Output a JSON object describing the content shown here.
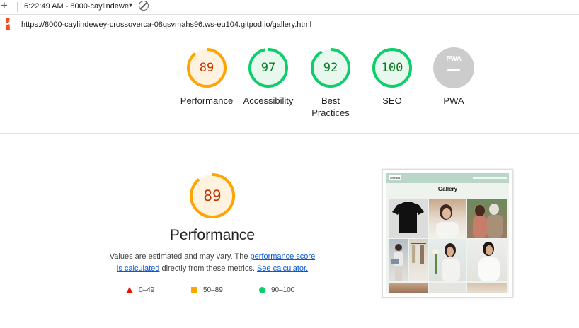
{
  "toolbar": {
    "timestamp": "6:22:49 AM - 8000-caylindewe"
  },
  "urlbar": {
    "url": "https://8000-caylindewey-crossoverca-08qsvmahs96.ws-eu104.gitpod.io/gallery.html"
  },
  "gauges": [
    {
      "label": "Performance",
      "score": "89",
      "value": 0.89,
      "status": "average",
      "color": "#ffa400"
    },
    {
      "label": "Accessibility",
      "score": "97",
      "value": 0.97,
      "status": "pass",
      "color": "#0cce6b"
    },
    {
      "label": "Best Practices",
      "score": "92",
      "value": 0.92,
      "status": "pass",
      "color": "#0cce6b"
    },
    {
      "label": "SEO",
      "score": "100",
      "value": 1.0,
      "status": "pass",
      "color": "#0cce6b"
    },
    {
      "label": "PWA",
      "badge": "PWA",
      "status": "na",
      "color": "#cccccc"
    }
  ],
  "performance": {
    "score": "89",
    "value": 0.89,
    "title": "Performance",
    "desc_prefix": "Values are estimated and may vary. The ",
    "link1": "performance score is calculated",
    "desc_middle": " directly from these metrics. ",
    "link2": "See calculator."
  },
  "legend": [
    {
      "range": "0–49",
      "shape": "triangle",
      "color": "#eb0f00"
    },
    {
      "range": "50–89",
      "shape": "square",
      "color": "#ffa400"
    },
    {
      "range": "90–100",
      "shape": "circle",
      "color": "#0cce6b"
    }
  ],
  "thumbnail": {
    "brand": "Threads",
    "title": "Gallery"
  },
  "colors": {
    "orange": "#ffa400",
    "green": "#0cce6b",
    "grey": "#cccccc",
    "link": "#0b57d0"
  }
}
